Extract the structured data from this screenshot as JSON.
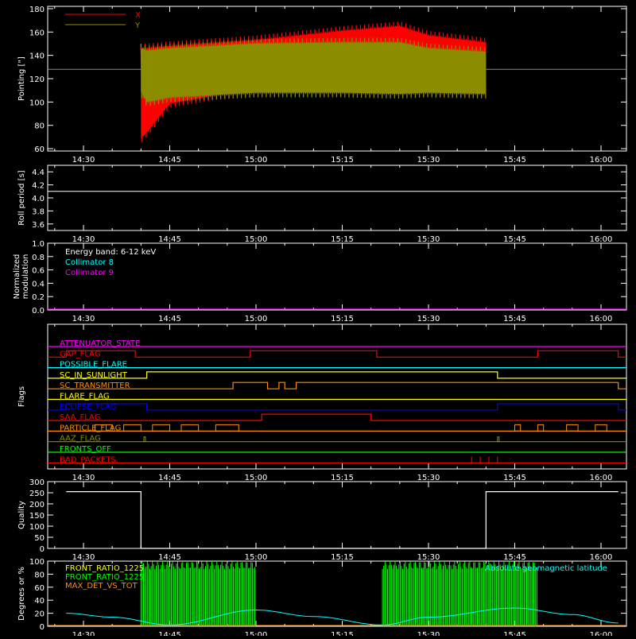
{
  "chart_data": [
    {
      "type": "line",
      "ylabel": "Pointing [\"]",
      "ylim": [
        58,
        182
      ],
      "yticks": [
        60,
        80,
        100,
        120,
        140,
        160,
        180
      ],
      "xlim_minutes": [
        870,
        970
      ],
      "xtick_labels": [
        "14:30",
        "14:45",
        "15:00",
        "15:15",
        "15:30",
        "15:45",
        "16:00"
      ],
      "reference_line": 128,
      "legend": [
        {
          "name": "X",
          "color": "#ff0000"
        },
        {
          "name": "Y",
          "color": "#8c8c00"
        }
      ],
      "series": [
        {
          "name": "X",
          "color": "#ff0000",
          "x": [
            "14:40",
            "14:41",
            "14:45",
            "15:00",
            "15:15",
            "15:25",
            "15:30",
            "15:40"
          ],
          "upper": [
            150,
            150,
            152,
            157,
            165,
            169,
            161,
            155
          ],
          "lower": [
            65,
            70,
            95,
            108,
            110,
            111,
            105,
            104
          ]
        },
        {
          "name": "Y",
          "color": "#8c8c00",
          "x": [
            "14:40",
            "14:41",
            "14:45",
            "15:00",
            "15:15",
            "15:25",
            "15:30",
            "15:40"
          ],
          "upper": [
            150,
            148,
            150,
            154,
            155,
            155,
            150,
            147
          ],
          "lower": [
            105,
            96,
            100,
            104,
            104,
            103,
            104,
            103
          ]
        }
      ]
    },
    {
      "type": "line",
      "ylabel": "Roll period [s]",
      "ylim": [
        3.5,
        4.5
      ],
      "yticks": [
        3.6,
        3.8,
        4.0,
        4.2,
        4.4
      ],
      "xtick_labels": [
        "14:30",
        "14:45",
        "15:00",
        "15:15",
        "15:30",
        "15:45",
        "16:00"
      ],
      "series": [
        {
          "name": "",
          "color": "#ffffff",
          "x": [
            "14:27",
            "16:03"
          ],
          "values": [
            4.1,
            4.1
          ]
        }
      ]
    },
    {
      "type": "line",
      "ylabel": "Normalized modulation",
      "ylim": [
        0,
        1
      ],
      "yticks": [
        0.0,
        0.2,
        0.4,
        0.6,
        0.8,
        1.0
      ],
      "xtick_labels": [
        "14:30",
        "14:45",
        "15:00",
        "15:15",
        "15:30",
        "15:45",
        "16:00"
      ],
      "annotations": [
        {
          "text": "Energy band: 6-12 keV",
          "color": "#ffffff"
        },
        {
          "text": "Collimator 8",
          "color": "#00ffff"
        },
        {
          "text": "Collimator 9",
          "color": "#ff00ff"
        }
      ],
      "series": [
        {
          "name": "Collimator 9",
          "color": "#ff00ff",
          "x": [
            "14:27",
            "16:03"
          ],
          "values": [
            0.0,
            0.0
          ]
        }
      ]
    },
    {
      "type": "line",
      "ylabel": "Flags",
      "xtick_labels": [
        "14:30",
        "14:45",
        "15:00",
        "15:15",
        "15:30",
        "15:45",
        "16:00"
      ],
      "flags": [
        {
          "name": "ATTENUATOR_STATE",
          "color": "#ff00ff",
          "high": []
        },
        {
          "name": "GAP_FLAG",
          "color": "#ff0000",
          "high": [
            [
              "14:27",
              "14:39"
            ],
            [
              "14:59",
              "15:21"
            ],
            [
              "15:49",
              "16:03"
            ]
          ]
        },
        {
          "name": "POSSIBLE_FLARE",
          "color": "#00ffff",
          "high": []
        },
        {
          "name": "SC_IN_SUNLIGHT",
          "color": "#ffff00",
          "high": [
            [
              "14:41",
              "15:42"
            ]
          ]
        },
        {
          "name": "SC_TRANSMITTER",
          "color": "#ff8c00",
          "high": [
            [
              "14:56",
              "15:02"
            ],
            [
              "15:04",
              "15:05"
            ],
            [
              "15:07",
              "16:03"
            ]
          ]
        },
        {
          "name": "FLARE_FLAG",
          "color": "#ffff00",
          "high": []
        },
        {
          "name": "ECLIPSE_FLAG",
          "color": "#0000ff",
          "high": [
            [
              "14:27",
              "14:41"
            ],
            [
              "15:42",
              "16:03"
            ]
          ]
        },
        {
          "name": "SAA_FLAG",
          "color": "#ff0000",
          "high": [
            [
              "15:01",
              "15:20"
            ]
          ]
        },
        {
          "name": "PARTICLE_FLAG",
          "color": "#ff8c00",
          "high": []
        },
        {
          "name": "AAZ_FLAG",
          "color": "#8c8c00",
          "high": []
        },
        {
          "name": "FRONTS_OFF",
          "color": "#00ff00",
          "high": []
        },
        {
          "name": "BAD_PACKETS",
          "color": "#ff0000",
          "high": []
        }
      ]
    },
    {
      "type": "line",
      "ylabel": "Quality",
      "ylim": [
        0,
        300
      ],
      "yticks": [
        0,
        50,
        100,
        150,
        200,
        250,
        300
      ],
      "xtick_labels": [
        "14:30",
        "14:45",
        "15:00",
        "15:15",
        "15:30",
        "15:45",
        "16:00"
      ],
      "series": [
        {
          "name": "",
          "color": "#ffffff",
          "x": [
            "14:27",
            "14:40",
            "14:40",
            "15:40",
            "15:40",
            "16:03"
          ],
          "values": [
            255,
            255,
            0,
            0,
            255,
            255
          ]
        }
      ]
    },
    {
      "type": "line",
      "ylabel": "Degrees or %",
      "ylim": [
        0,
        100
      ],
      "yticks": [
        0,
        20,
        40,
        60,
        80,
        100
      ],
      "xtick_labels": [
        "14:30",
        "14:45",
        "15:00",
        "15:15",
        "15:30",
        "15:45",
        "16:00"
      ],
      "legend": [
        {
          "name": "FRONT_RATIO_1225",
          "color": "#ffff00"
        },
        {
          "name": "FRONT_RATIO_1225",
          "color": "#00ff00"
        },
        {
          "name": "MAX_DET_VS_TOT",
          "color": "#ff8c00"
        },
        {
          "name": "Absolute geomagnetic latitude",
          "color": "#00ffff"
        }
      ],
      "series": [
        {
          "name": "Absolute geomagnetic latitude",
          "color": "#00ffff",
          "x": [
            "14:27",
            "14:35",
            "14:45",
            "15:00",
            "15:10",
            "15:22",
            "15:30",
            "15:45",
            "15:55",
            "16:03"
          ],
          "values": [
            20,
            14,
            2,
            25,
            15,
            2,
            14,
            28,
            18,
            5
          ]
        },
        {
          "name": "FRONT_RATIO_1225",
          "color": "#00ff00",
          "x": [
            "14:40",
            "15:00",
            "15:22",
            "15:49"
          ],
          "values": [
            100,
            100,
            100,
            100
          ]
        }
      ]
    }
  ]
}
